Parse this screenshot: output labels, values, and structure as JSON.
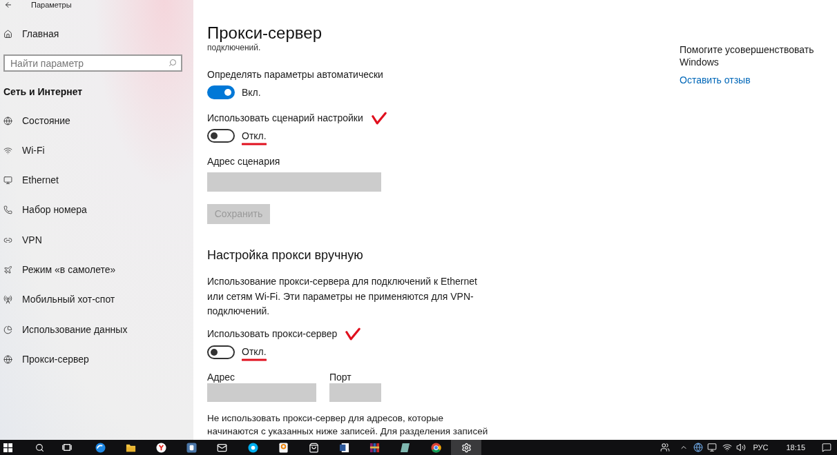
{
  "window": {
    "title": "Параметры"
  },
  "sidebar": {
    "home": "Главная",
    "search": {
      "placeholder": "Найти параметр"
    },
    "section": "Сеть и Интернет",
    "items": [
      {
        "label": "Состояние"
      },
      {
        "label": "Wi-Fi"
      },
      {
        "label": "Ethernet"
      },
      {
        "label": "Набор номера"
      },
      {
        "label": "VPN"
      },
      {
        "label": "Режим «в самолете»"
      },
      {
        "label": "Мобильный хот-спот"
      },
      {
        "label": "Использование данных"
      },
      {
        "label": "Прокси-сервер"
      }
    ]
  },
  "page": {
    "title": "Прокси-сервер",
    "automatic": {
      "cut_text": "подключений.",
      "settings": [
        {
          "label": "Определять параметры автоматически",
          "on": true,
          "state_text": "Вкл.",
          "marked": false
        },
        {
          "label": "Использовать сценарий настройки",
          "on": false,
          "state_text": "Откл.",
          "marked": true
        }
      ],
      "script_address": {
        "label": "Адрес сценария",
        "disabled": true
      },
      "save_button": {
        "label": "Сохранить",
        "disabled": true
      }
    },
    "manual": {
      "heading": "Настройка прокси вручную",
      "description": "Использование прокси-сервера для подключений к Ethernet или сетям Wi-Fi. Эти параметры не применяются для VPN-подключений.",
      "setting": {
        "label": "Использовать прокси-сервер",
        "on": false,
        "state_text": "Откл.",
        "marked": true
      },
      "address": {
        "label": "Адрес",
        "disabled": true
      },
      "port": {
        "label": "Порт",
        "disabled": true
      },
      "exceptions_text": "Не использовать прокси-сервер для адресов, которые начинаются с указанных ниже записей. Для разделения записей"
    }
  },
  "aside": {
    "text": "Помогите усовершенствовать Windows",
    "link": "Оставить отзыв"
  },
  "taskbar": {
    "apps": [
      {
        "selected": false
      },
      {
        "selected": false
      },
      {
        "selected": false
      },
      {
        "selected": false
      },
      {
        "selected": false
      },
      {
        "selected": false
      },
      {
        "selected": false
      },
      {
        "selected": false
      },
      {
        "selected": false
      },
      {
        "selected": false
      },
      {
        "selected": false
      },
      {
        "selected": false
      },
      {
        "selected": true
      }
    ],
    "language": "РУС",
    "time": "18:15"
  }
}
